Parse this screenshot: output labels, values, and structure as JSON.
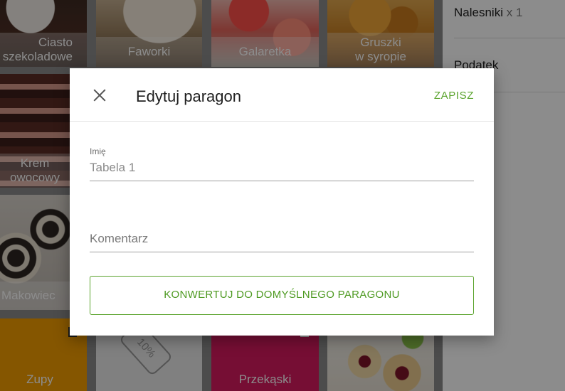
{
  "tiles": [
    {
      "name": "Ciasto szekoladowe",
      "line1": "Ciasto",
      "line2": "szekoladowe"
    },
    {
      "name": "Faworki",
      "line1": "Faworki",
      "line2": ""
    },
    {
      "name": "Galaretka",
      "line1": "Galaretka",
      "line2": ""
    },
    {
      "name": "Gruszki w syropie",
      "line1": "Gruszki",
      "line2": "w syropie"
    },
    {
      "name": "Krem owocowy",
      "line1": "Krem",
      "line2": "owocowy"
    },
    {
      "name": "Makowiec",
      "line1": "Makowiec",
      "line2": ""
    },
    {
      "name": "Zupy",
      "line1": "Zupy",
      "line2": ""
    },
    {
      "name": "Discount",
      "line1": "10%",
      "line2": ""
    },
    {
      "name": "Przekąski",
      "line1": "Przekąski",
      "line2": ""
    }
  ],
  "receipt": {
    "items": [
      {
        "name": "Nalesniki",
        "qty": "x 1"
      },
      {
        "name": "Podatek",
        "qty": ""
      }
    ]
  },
  "dialog": {
    "title": "Edytuj paragon",
    "save_label": "ZAPISZ",
    "name_label": "Imię",
    "name_value": "Tabela 1",
    "comment_placeholder": "Komentarz",
    "convert_label": "KONWERTUJ DO DOMYŚLNEGO PARAGONU"
  }
}
